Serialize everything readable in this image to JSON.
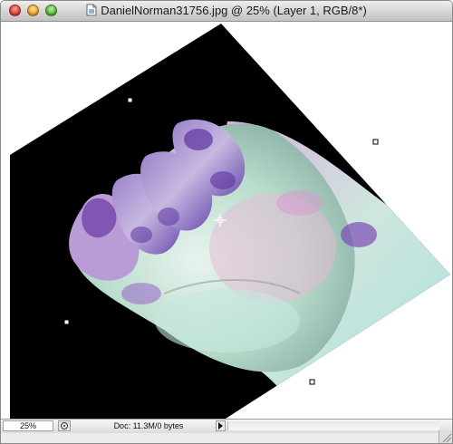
{
  "window": {
    "title": "DanielNorman31756.jpg @ 25% (Layer 1, RGB/8*)"
  },
  "status": {
    "zoom": "25%",
    "doc_info": "Doc: 11.3M/0 bytes"
  },
  "icons": {
    "document": "document-icon",
    "status_menu": "status-menu-icon",
    "arrow": "right-arrow-icon",
    "grow": "resize-grip-icon"
  },
  "colors": {
    "photo_background": "#000000",
    "canvas_background": "#ffffff",
    "skin_tone": "#b8d9c9",
    "purple_tone": "#7b58b0"
  }
}
